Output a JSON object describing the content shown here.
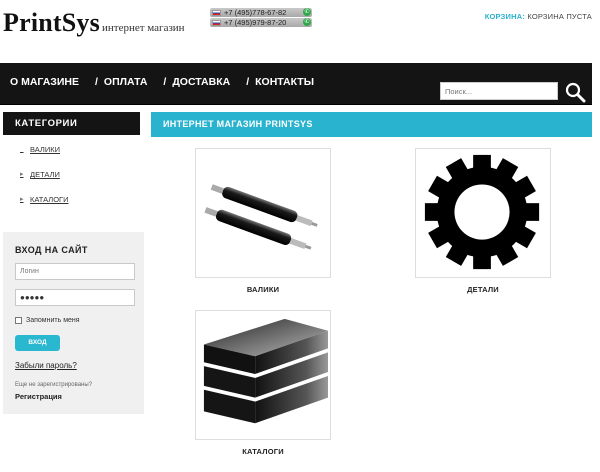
{
  "header": {
    "logo": "PrintSys",
    "tagline": "интернет магазин",
    "phones": [
      "+7 (495)778-67-82",
      "+7 (495)979-87-20"
    ],
    "cart_label": "КОРЗИНА:",
    "cart_status": "КОРЗИНА ПУСТА"
  },
  "nav": {
    "items": [
      {
        "label": "О МАГАЗИНЕ"
      },
      {
        "label": "ОПЛАТА"
      },
      {
        "label": "ДОСТАВКА"
      },
      {
        "label": "КОНТАКТЫ"
      }
    ],
    "separator": "/",
    "search_placeholder": "Поиск...",
    "search_icon": "search-icon"
  },
  "sidebar": {
    "categories_title": "КАТЕГОРИИ",
    "categories": [
      {
        "label": "ВАЛИКИ",
        "has_arrow": false
      },
      {
        "label": "ДЕТАЛИ",
        "has_arrow": true
      },
      {
        "label": "КАТАЛОГИ",
        "has_arrow": true
      }
    ],
    "arrow_glyph": "▸"
  },
  "login": {
    "title": "ВХОД НА САЙТ",
    "login_placeholder": "Логин",
    "password_value": "●●●●●",
    "remember_label": "Запомнить меня",
    "submit_label": "ВХОД",
    "forgot_label": "Забыли пароль?",
    "not_registered": "Еще не зарегистрированы?",
    "register_label": "Регистрация"
  },
  "main": {
    "title": "ИНТЕРНЕТ МАГАЗИН PRINTSYS",
    "products": [
      {
        "name": "ВАЛИКИ",
        "icon": "rollers-image"
      },
      {
        "name": "ДЕТАЛИ",
        "icon": "gear-icon"
      },
      {
        "name": "КАТАЛОГИ",
        "icon": "books-image"
      }
    ]
  },
  "colors": {
    "accent": "#29b3cf",
    "nav_bg": "#141414",
    "call_green": "#2fa74a"
  }
}
